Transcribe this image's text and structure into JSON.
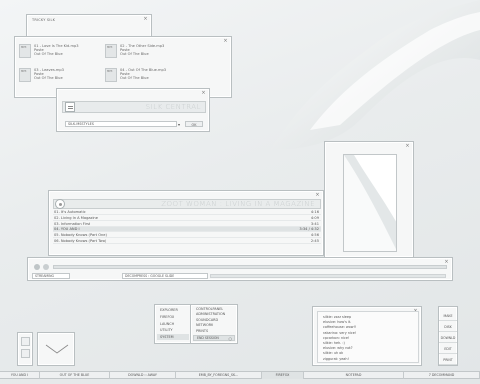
{
  "colors": {
    "window_bg": "#f6f7f7",
    "border": "#b9bfc1",
    "highlight": "#dfe3e4",
    "text": "#555555"
  },
  "small_window": {
    "title": "TRICKY SILK"
  },
  "files_window": {
    "items": [
      {
        "thumb": "MP3",
        "name": "01 - Love Is The Kid.mp3",
        "artist": "Poste",
        "album": "Out Of The Blue"
      },
      {
        "thumb": "MP3",
        "name": "02 - The Other Side.mp3",
        "artist": "Poste",
        "album": "Out Of The Blue"
      },
      {
        "thumb": "MP3",
        "name": "03 - Leaves.mp3",
        "artist": "Poste",
        "album": "Out Of The Blue"
      },
      {
        "thumb": "MP3",
        "name": "04 - Out Of The Blue.mp3",
        "artist": "Poste",
        "album": "Out Of The Blue"
      }
    ]
  },
  "silk_window": {
    "title": "SILK CENTRAL",
    "input_value": "SILK.MSSTYLES",
    "ok_label": "OK"
  },
  "image_window": {},
  "player": {
    "title": "ZOOT WOMAN : LIVING IN A MAGAZINE",
    "tracks": [
      {
        "name": "01. It's Automatic",
        "duration": "4:16",
        "selected": false
      },
      {
        "name": "02. Living In A Magazine",
        "duration": "4:09",
        "selected": false
      },
      {
        "name": "03. Information First",
        "duration": "3:41",
        "selected": false
      },
      {
        "name": "04. YOU AND I",
        "duration": "3:34 / 4:32",
        "selected": true
      },
      {
        "name": "05. Nobody Knows (Part One)",
        "duration": "4:56",
        "selected": false
      },
      {
        "name": "06. Nobody Knows (Part Two)",
        "duration": "2:45",
        "selected": false
      }
    ]
  },
  "mini_player": {
    "left_label": "STREAMING",
    "status": "DECOMPRESS : GOOGLE SLIDE"
  },
  "start_menu": {
    "left_items": [
      "EXPLORER",
      "FIREFOX",
      "LAUNCH",
      "UTILITY",
      "SYSTEM"
    ],
    "right_items": [
      "CONTROLPANEL",
      "ADMINISTRATION",
      "SOUNDCARD",
      "NETWORK",
      "PRINTS"
    ],
    "footer": "END SESSION"
  },
  "chat_window": {
    "lines": [
      "silkie: zzzz sleep",
      "elusive: how's it.",
      "coffeehouse: wow!!",
      "rakarina: very nice!",
      "cpcarbon: nice!",
      "silkie: heh. :)",
      "elusive: why not?",
      "silkie: uh ok",
      "ziggurat: yeah!"
    ]
  },
  "side_panel": {
    "items": [
      "MAKE",
      "DISK",
      "DOWNLD",
      "EDIT",
      "PRINT"
    ]
  },
  "taskbar": {
    "items": [
      "YOU AND I",
      "OUT OF THE BLUE",
      "DOWNLD :: AWAY",
      "EMB_BY_FOREGNS_SK...",
      "FIREFOX",
      "NOTEPAD",
      "7 DECOMMAND"
    ]
  }
}
